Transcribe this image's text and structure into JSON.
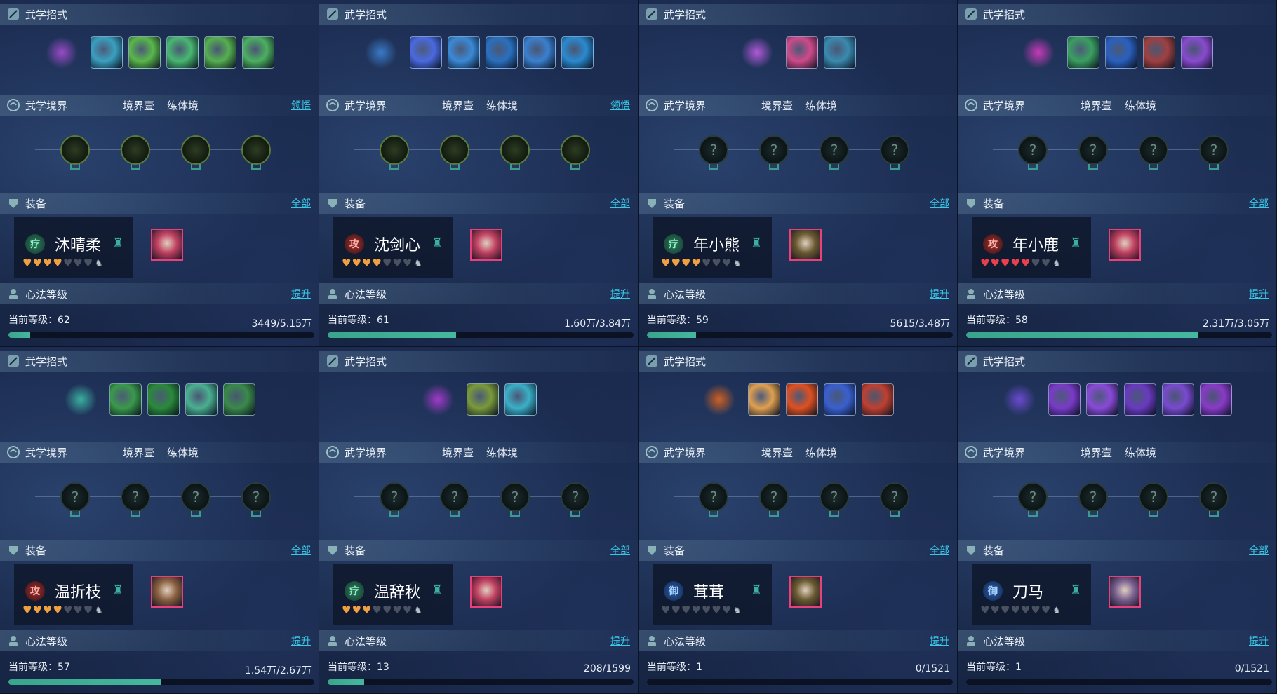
{
  "labels": {
    "skills_title": "武学招式",
    "realm_title": "武学境界",
    "realm_level": "境界壹",
    "realm_stage": "练体境",
    "equip_title": "装备",
    "equip_link": "全部",
    "xinfa_title": "心法等级",
    "xinfa_link": "提升",
    "level_prefix": "当前等级：",
    "realm_link": "领悟"
  },
  "panels": [
    {
      "name": "沐晴柔",
      "role": "疗",
      "role_type": "heal",
      "hearts_on": 4,
      "hearts_red": 0,
      "level": "62",
      "exp": "3449/5.15万",
      "progress": 0.07,
      "realm_link": true,
      "realm_lit": true,
      "skills": [
        "#9a4ac8",
        "#3aa0c0",
        "#5ab84a",
        "#48b870",
        "#56b050",
        "#4cb060"
      ],
      "equip": "#c04060"
    },
    {
      "name": "沈剑心",
      "role": "攻",
      "role_type": "atk",
      "hearts_on": 4,
      "hearts_red": 0,
      "level": "61",
      "exp": "1.60万/3.84万",
      "progress": 0.42,
      "realm_link": true,
      "realm_lit": true,
      "skills": [
        "#3a7ac8",
        "#4a6ae0",
        "#3a8ad8",
        "#2a70c0",
        "#3a80d0",
        "#2a8ad0"
      ],
      "equip": "#c04060"
    },
    {
      "name": "年小熊",
      "role": "疗",
      "role_type": "heal",
      "hearts_on": 4,
      "hearts_red": 0,
      "level": "59",
      "exp": "5615/3.48万",
      "progress": 0.16,
      "realm_link": false,
      "realm_lit": false,
      "skills": [
        "#b05ad8",
        "#d04a8a",
        "#3a8ab0"
      ],
      "equip": "#6a5a30"
    },
    {
      "name": "年小鹿",
      "role": "攻",
      "role_type": "atk",
      "hearts_on": 0,
      "hearts_red": 5,
      "level": "58",
      "exp": "2.31万/3.05万",
      "progress": 0.76,
      "realm_link": false,
      "realm_lit": false,
      "skills": [
        "#c83ab8",
        "#3aa060",
        "#2a60c0",
        "#a04040",
        "#8a4ad0"
      ],
      "equip": "#c04060"
    },
    {
      "name": "温折枝",
      "role": "攻",
      "role_type": "atk",
      "hearts_on": 4,
      "hearts_red": 0,
      "level": "57",
      "exp": "1.54万/2.67万",
      "progress": 0.5,
      "realm_link": false,
      "realm_lit": false,
      "skills": [
        "#3ab0a0",
        "#3a9a4a",
        "#2a8a3a",
        "#4ab090",
        "#3a8a4a"
      ],
      "equip": "#8a6040"
    },
    {
      "name": "温辞秋",
      "role": "疗",
      "role_type": "heal",
      "hearts_on": 3,
      "hearts_red": 0,
      "level": "13",
      "exp": "208/1599",
      "progress": 0.12,
      "realm_link": false,
      "realm_lit": false,
      "skills": [
        "#a03ac8",
        "#7a9a3a",
        "#3ab0c8"
      ],
      "equip": "#c04060"
    },
    {
      "name": "茸茸",
      "role": "御",
      "role_type": "def",
      "hearts_on": 0,
      "hearts_red": 0,
      "level": "1",
      "exp": "0/1521",
      "progress": 0.0,
      "realm_link": false,
      "realm_lit": false,
      "skills": [
        "#d06020",
        "#e0a050",
        "#e05020",
        "#3a60d0",
        "#c04030"
      ],
      "equip": "#6a5a30"
    },
    {
      "name": "刀马",
      "role": "御",
      "role_type": "def",
      "hearts_on": 0,
      "hearts_red": 0,
      "level": "1",
      "exp": "0/1521",
      "progress": 0.0,
      "realm_link": false,
      "realm_lit": false,
      "skills": [
        "#6a4ad0",
        "#7a3ac8",
        "#8a4ad8",
        "#6a3ac0",
        "#7a4ad0",
        "#8a3ac8"
      ],
      "equip": "#7a6090"
    }
  ]
}
